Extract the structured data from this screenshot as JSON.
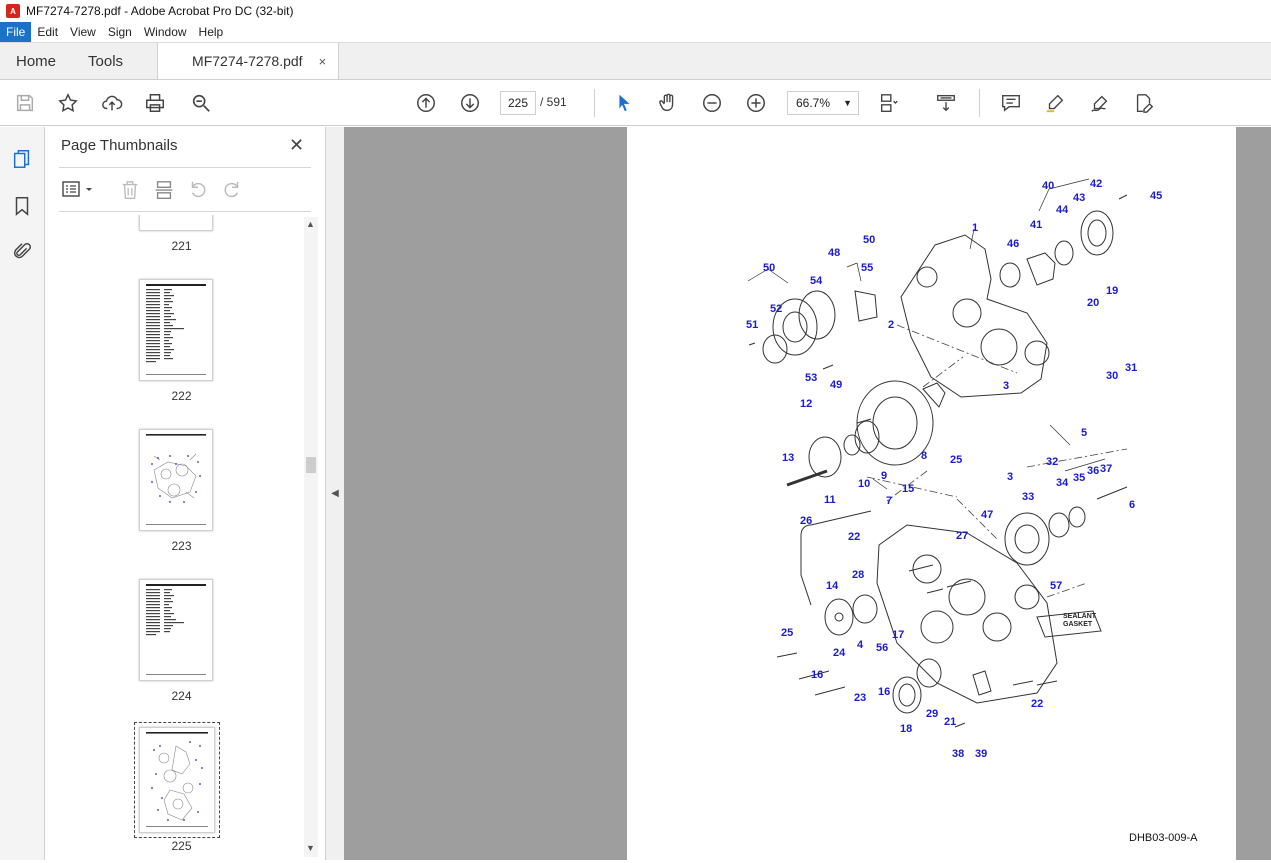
{
  "window": {
    "title": "MF7274-7278.pdf - Adobe Acrobat Pro DC (32-bit)"
  },
  "menu": {
    "items": [
      "File",
      "Edit",
      "View",
      "Sign",
      "Window",
      "Help"
    ]
  },
  "tabs": {
    "home": "Home",
    "tools": "Tools",
    "document": "MF7274-7278.pdf",
    "close": "×"
  },
  "toolbar": {
    "page_current": "225",
    "page_total": "/ 591",
    "zoom": "66.7%",
    "icons": [
      "save-icon",
      "bookmark-star-icon",
      "upload-icon",
      "print-icon",
      "search-zoom-icon",
      "page-up-icon",
      "page-down-icon",
      "select-cursor-icon",
      "hand-icon",
      "zoom-out-icon",
      "zoom-in-icon",
      "fit-page-icon",
      "scroll-mode-icon",
      "comment-icon",
      "highlight-icon",
      "sign-icon",
      "edit-icon"
    ]
  },
  "sidebar": {
    "title": "Page Thumbnails",
    "close": "✕",
    "thumbnails": [
      {
        "label": "221",
        "kind": "text"
      },
      {
        "label": "222",
        "kind": "text"
      },
      {
        "label": "223",
        "kind": "diagram"
      },
      {
        "label": "224",
        "kind": "text"
      },
      {
        "label": "225",
        "kind": "diagram",
        "selected": true
      }
    ]
  },
  "document": {
    "figure_id": "DHB03-009-A",
    "sealant_label": [
      "SEALANT",
      "GASKET"
    ],
    "callouts": [
      "1",
      "2",
      "3",
      "3",
      "4",
      "5",
      "6",
      "7",
      "8",
      "9",
      "10",
      "11",
      "12",
      "13",
      "14",
      "15",
      "16",
      "16",
      "17",
      "18",
      "19",
      "20",
      "21",
      "22",
      "22",
      "23",
      "24",
      "25",
      "25",
      "26",
      "27",
      "28",
      "29",
      "30",
      "31",
      "32",
      "33",
      "34",
      "35",
      "36",
      "37",
      "38",
      "39",
      "40",
      "41",
      "42",
      "43",
      "44",
      "45",
      "46",
      "47",
      "48",
      "49",
      "50",
      "50",
      "51",
      "52",
      "53",
      "54",
      "55",
      "56",
      "57"
    ]
  }
}
